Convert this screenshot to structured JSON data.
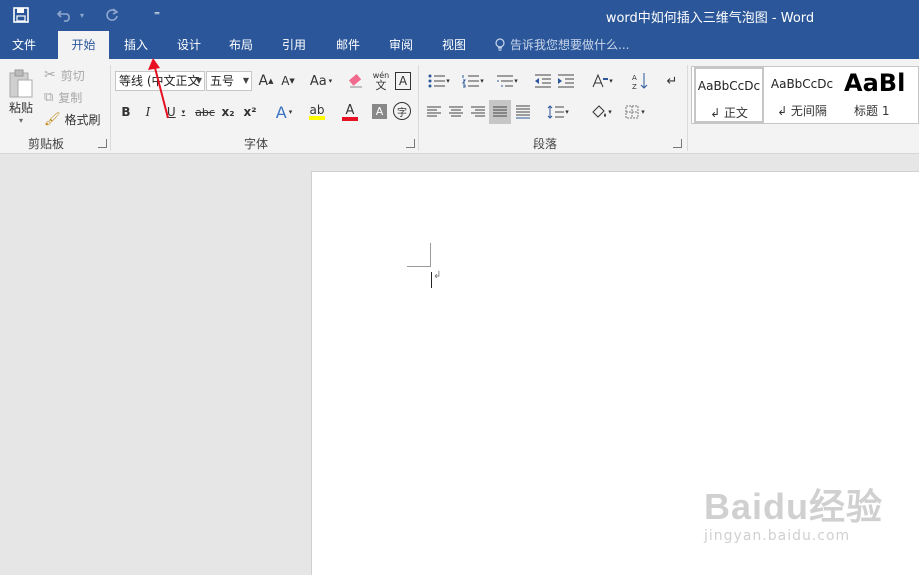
{
  "titlebar": {
    "title": "word中如何插入三维气泡图 - Word",
    "qat": {
      "save_icon": "save-icon",
      "undo_icon": "undo-icon",
      "redo_icon": "redo-icon",
      "customize_label": "⁼"
    }
  },
  "tabs": [
    {
      "label": "文件"
    },
    {
      "label": "开始",
      "active": true
    },
    {
      "label": "插入"
    },
    {
      "label": "设计"
    },
    {
      "label": "布局"
    },
    {
      "label": "引用"
    },
    {
      "label": "邮件"
    },
    {
      "label": "审阅"
    },
    {
      "label": "视图"
    }
  ],
  "tellme": {
    "placeholder": "告诉我您想要做什么..."
  },
  "ribbon": {
    "clipboard": {
      "paste_label": "粘贴",
      "cut_label": "剪切",
      "copy_label": "复制",
      "format_painter_label": "格式刷",
      "group_label": "剪贴板"
    },
    "font": {
      "font_name": "等线 (中文正文",
      "font_size": "五号",
      "grow_label": "A",
      "shrink_label": "A",
      "case_label": "Aa",
      "phonetic_label": "wén",
      "phonetic_char": "文",
      "border_char": "A",
      "bold": "B",
      "italic": "I",
      "underline": "U",
      "strike": "abc",
      "subscript": "x₂",
      "superscript": "x²",
      "effects": "A",
      "font_color": "A",
      "shade_char": "A",
      "enclose_char": "字",
      "group_label": "字体",
      "highlight_color": "#ffff00",
      "font_color_value": "#e81123"
    },
    "paragraph": {
      "group_label": "段落"
    },
    "styles": [
      {
        "sample": "AaBbCcDc",
        "name": "↲ 正文"
      },
      {
        "sample": "AaBbCcDc",
        "name": "↲ 无间隔"
      },
      {
        "sample": "AaBl",
        "name": "标题 1"
      }
    ]
  },
  "watermark": {
    "logo": "Baidu经验",
    "url": "jingyan.baidu.com"
  },
  "colors": {
    "accent": "#2b579a",
    "ribbon_bg": "#f3f3f3",
    "annotation_arrow": "#e81123"
  }
}
